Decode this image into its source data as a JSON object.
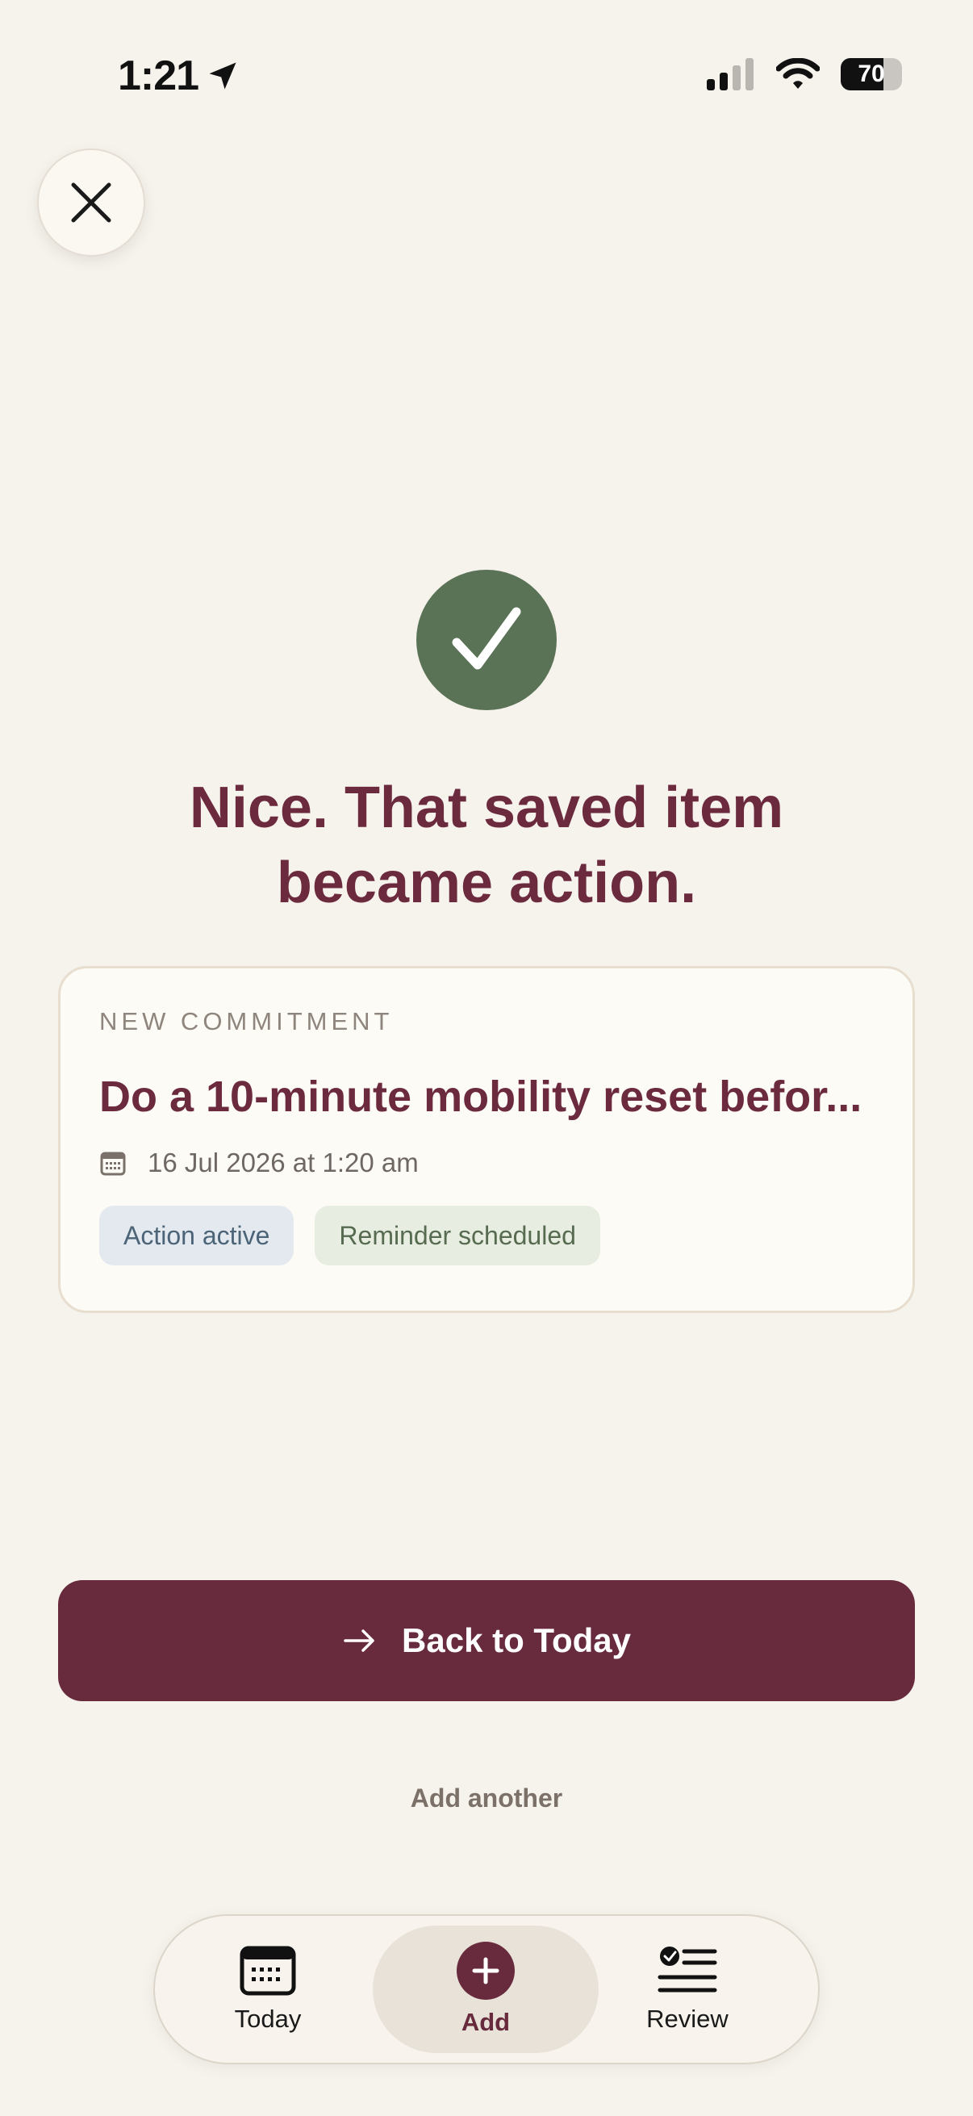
{
  "status_bar": {
    "time": "1:21",
    "battery_level": "70",
    "battery_fraction": 0.7
  },
  "header": {
    "close_icon": "close-icon"
  },
  "success": {
    "icon": "checkmark-icon",
    "headline": "Nice. That saved item became action."
  },
  "card": {
    "eyebrow": "NEW COMMITMENT",
    "title": "Do a 10-minute mobility reset befor...",
    "date": "16 Jul 2026 at 1:20 am",
    "tags": [
      {
        "label": "Action active"
      },
      {
        "label": "Reminder scheduled"
      }
    ]
  },
  "actions": {
    "primary_label": "Back to Today",
    "secondary_label": "Add another"
  },
  "tabbar": {
    "items": [
      {
        "label": "Today",
        "icon": "calendar-icon"
      },
      {
        "label": "Add",
        "icon": "plus-icon"
      },
      {
        "label": "Review",
        "icon": "review-list-icon"
      }
    ]
  },
  "colors": {
    "background": "#f6f2ec",
    "brand": "#682b3e",
    "success": "#5a7255"
  }
}
